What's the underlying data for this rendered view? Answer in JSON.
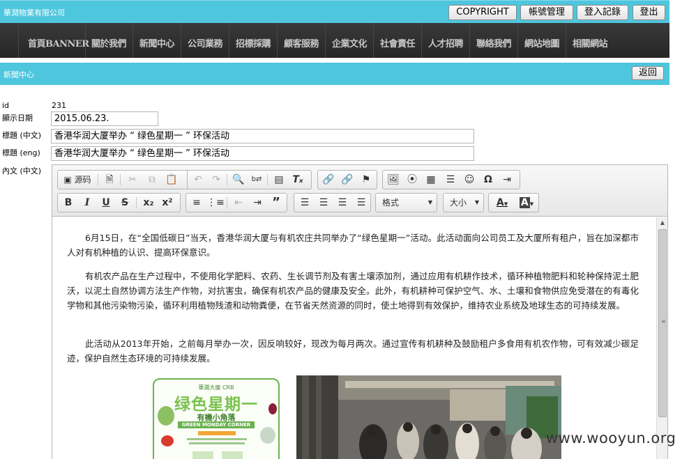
{
  "header": {
    "company": "華潤物業有限公司",
    "buttons": {
      "copyright": "COPYRIGHT",
      "account": "帳號管理",
      "login_log": "登入記錄",
      "logout": "登出"
    }
  },
  "nav": {
    "items": [
      "首頁BANNER",
      "關於我們",
      "新聞中心",
      "公司業務",
      "招標採購",
      "顧客服務",
      "企業文化",
      "社會責任",
      "人才招聘",
      "聯絡我們",
      "網站地圖",
      "相關網站"
    ]
  },
  "section": {
    "title": "新聞中心",
    "back": "返回"
  },
  "form": {
    "id_label": "id",
    "id_value": "231",
    "date_label": "顯示日期",
    "date_value": "2015.06.23.",
    "title_zh_label": "標題 (中文)",
    "title_zh_value": "香港华润大厦举办 “ 绿色星期一 ” 环保活动",
    "title_en_label": "標題 (eng)",
    "title_en_value": "香港华润大厦举办 “ 绿色星期一 ” 环保活动",
    "content_label": "內文 (中文)"
  },
  "editor": {
    "source_label": "源码",
    "format_combo": "格式",
    "size_combo": "大小",
    "icons": {
      "source": "source-icon",
      "templates": "templates-icon",
      "cut": "cut-icon",
      "copy": "copy-icon",
      "paste": "paste-icon",
      "undo": "undo-icon",
      "redo": "redo-icon",
      "find": "find-icon",
      "replace": "replace-icon",
      "select_all": "select-all-icon",
      "remove_format": "remove-format-icon",
      "link": "link-icon",
      "unlink": "unlink-icon",
      "anchor": "anchor-icon",
      "image": "image-icon",
      "flash": "flash-icon",
      "table": "table-icon",
      "hr": "horizontal-rule-icon",
      "smiley": "smiley-icon",
      "special_char": "omega-icon",
      "page_break": "page-break-icon"
    },
    "format_buttons": {
      "bold": "B",
      "italic": "I",
      "underline": "U",
      "strike": "S",
      "subscript": "x₂",
      "superscript": "x²"
    },
    "paragraphs": [
      "6月15日，在“全国低碳日”当天，香港华润大厦与有机农庄共同举办了“绿色星期一”活动。此活动面向公司员工及大厦所有租户，旨在加深都市人对有机种植的认识、提高环保意识。",
      "有机农产品在生产过程中，不使用化学肥料、农药、生长调节剂及有害土壤添加剂，通过应用有机耕作技术，循环种植物肥料和轮种保持泥土肥沃，以泥土自然协调方法生产作物，对抗害虫，确保有机农产品的健康及安全。此外，有机耕种可保护空气、水、土壤和食物供应免受潜在的有毒化学物和其他污染物污染，循环利用植物残渣和动物粪便，在节省天然资源的同时，使土地得到有效保护，维持农业系统及地球生态的可持续发展。",
      "此活动从2013年开始，之前每月举办一次，因反响较好，现改为每月两次。通过宣传有机耕种及鼓励租户多食用有机农作物，可有效减少碳足迹，保护自然生态环境的可持续发展。"
    ],
    "poster": {
      "brand": "華潤大廈 CRB",
      "title": "绿色星期一",
      "subtitle": "有機小角落",
      "english": "GREEN MONDAY CORNER"
    }
  },
  "watermark": "www.wooyun.org",
  "colors": {
    "accent": "#4ec6de",
    "nav_bg": "#2e2e2e",
    "poster_green": "#6ab24e"
  }
}
